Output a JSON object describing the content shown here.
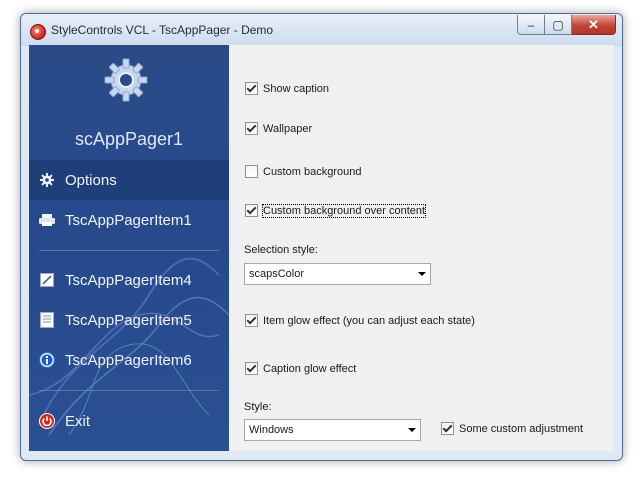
{
  "window": {
    "title": "StyleControls VCL - TscAppPager - Demo"
  },
  "titlebar_buttons": {
    "minimize": "‒",
    "maximize": "▢",
    "close": "✕"
  },
  "sidebar": {
    "title": "scAppPager1",
    "items": [
      {
        "label": "Options",
        "icon": "gear-icon",
        "selected": true
      },
      {
        "label": "TscAppPagerItem1",
        "icon": "printer-icon"
      },
      {
        "label": "TscAppPagerItem4",
        "icon": "edit-icon"
      },
      {
        "label": "TscAppPagerItem5",
        "icon": "document-icon"
      },
      {
        "label": "TscAppPagerItem6",
        "icon": "info-icon"
      },
      {
        "label": "Exit",
        "icon": "power-icon"
      }
    ]
  },
  "options": {
    "show_caption": {
      "label": "Show caption",
      "checked": true
    },
    "wallpaper": {
      "label": "Wallpaper",
      "checked": true
    },
    "custom_background": {
      "label": "Custom background",
      "checked": false
    },
    "custom_background_over_content": {
      "label": "Custom background over content",
      "checked": true
    },
    "selection_style_label": "Selection style:",
    "selection_style_value": "scapsColor",
    "item_glow": {
      "label": "Item glow effect (you can adjust each state)",
      "checked": true
    },
    "caption_glow": {
      "label": "Caption glow effect",
      "checked": true
    },
    "style_label": "Style:",
    "style_value": "Windows",
    "some_custom_adjustment": {
      "label": "Some custom adjustment",
      "checked": true
    }
  },
  "colors": {
    "sidebar": "#274a8d",
    "selected_item": "#1f3f7a",
    "content_bg": "#f0f0f0"
  }
}
